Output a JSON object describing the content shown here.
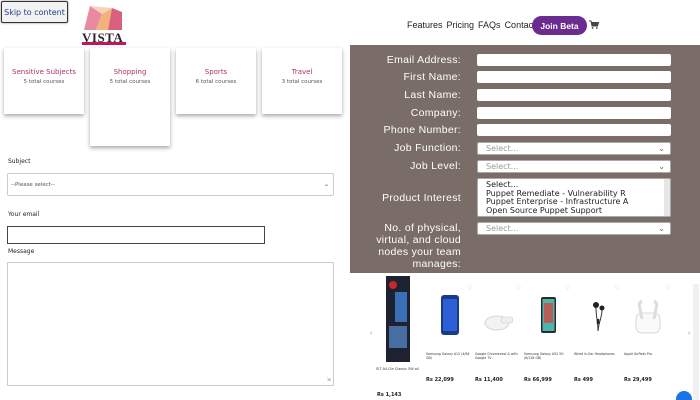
{
  "header": {
    "skip_link": "Skip to content",
    "logo_text": "VISTA",
    "nav": [
      "Features",
      "Pricing",
      "FAQs",
      "Contact"
    ],
    "join_button": "Join Beta",
    "brand_color": "#6b2c8f"
  },
  "categories": [
    {
      "title": "Sensitive Subjects",
      "count": "5 total courses"
    },
    {
      "title": "Shopping",
      "count": "5 total courses"
    },
    {
      "title": "Sports",
      "count": "6 total courses"
    },
    {
      "title": "Travel",
      "count": "3 total courses"
    }
  ],
  "contact_form": {
    "subject_label": "Subject",
    "subject_value": "--Please select--",
    "email_label": "Your email",
    "message_label": "Message"
  },
  "lead_form": {
    "email_label": "Email Address:",
    "first_name_label": "First Name:",
    "last_name_label": "Last Name:",
    "company_label": "Company:",
    "phone_label": "Phone Number:",
    "job_function_label": "Job Function:",
    "job_function_value": "Select...",
    "job_level_label": "Job Level:",
    "job_level_value": "Select...",
    "product_interest_label": "Product Interest",
    "product_options": [
      "Select...",
      "Puppet Remediate - Vulnerability R",
      "Puppet Enterprise - Infrastructure A",
      "Open Source Puppet Support"
    ],
    "nodes_label_1": "No. of physical,",
    "nodes_label_2": "virtual, and cloud",
    "nodes_label_3": "nodes your team",
    "nodes_label_4": "manages:",
    "nodes_value": "Select...",
    "panel_color": "#7a6d67"
  },
  "products": {
    "promo_name": "SIT All-Cle Classic 5W all",
    "promo_price": "Rs 1,143",
    "items": [
      {
        "name": "Samsung Galaxy A12 (4/64 GB)",
        "price": "Rs 22,099"
      },
      {
        "name": "Google Chromecast & with Google TV",
        "price": "Rs 11,400"
      },
      {
        "name": "Samsung Galaxy A52 5G (6/128 GB)",
        "price": "Rs 66,999"
      },
      {
        "name": "Wired In-Ear Headphones",
        "price": "Rs 499"
      },
      {
        "name": "Apple AirPods Pro",
        "price": "Rs 29,499"
      }
    ]
  }
}
